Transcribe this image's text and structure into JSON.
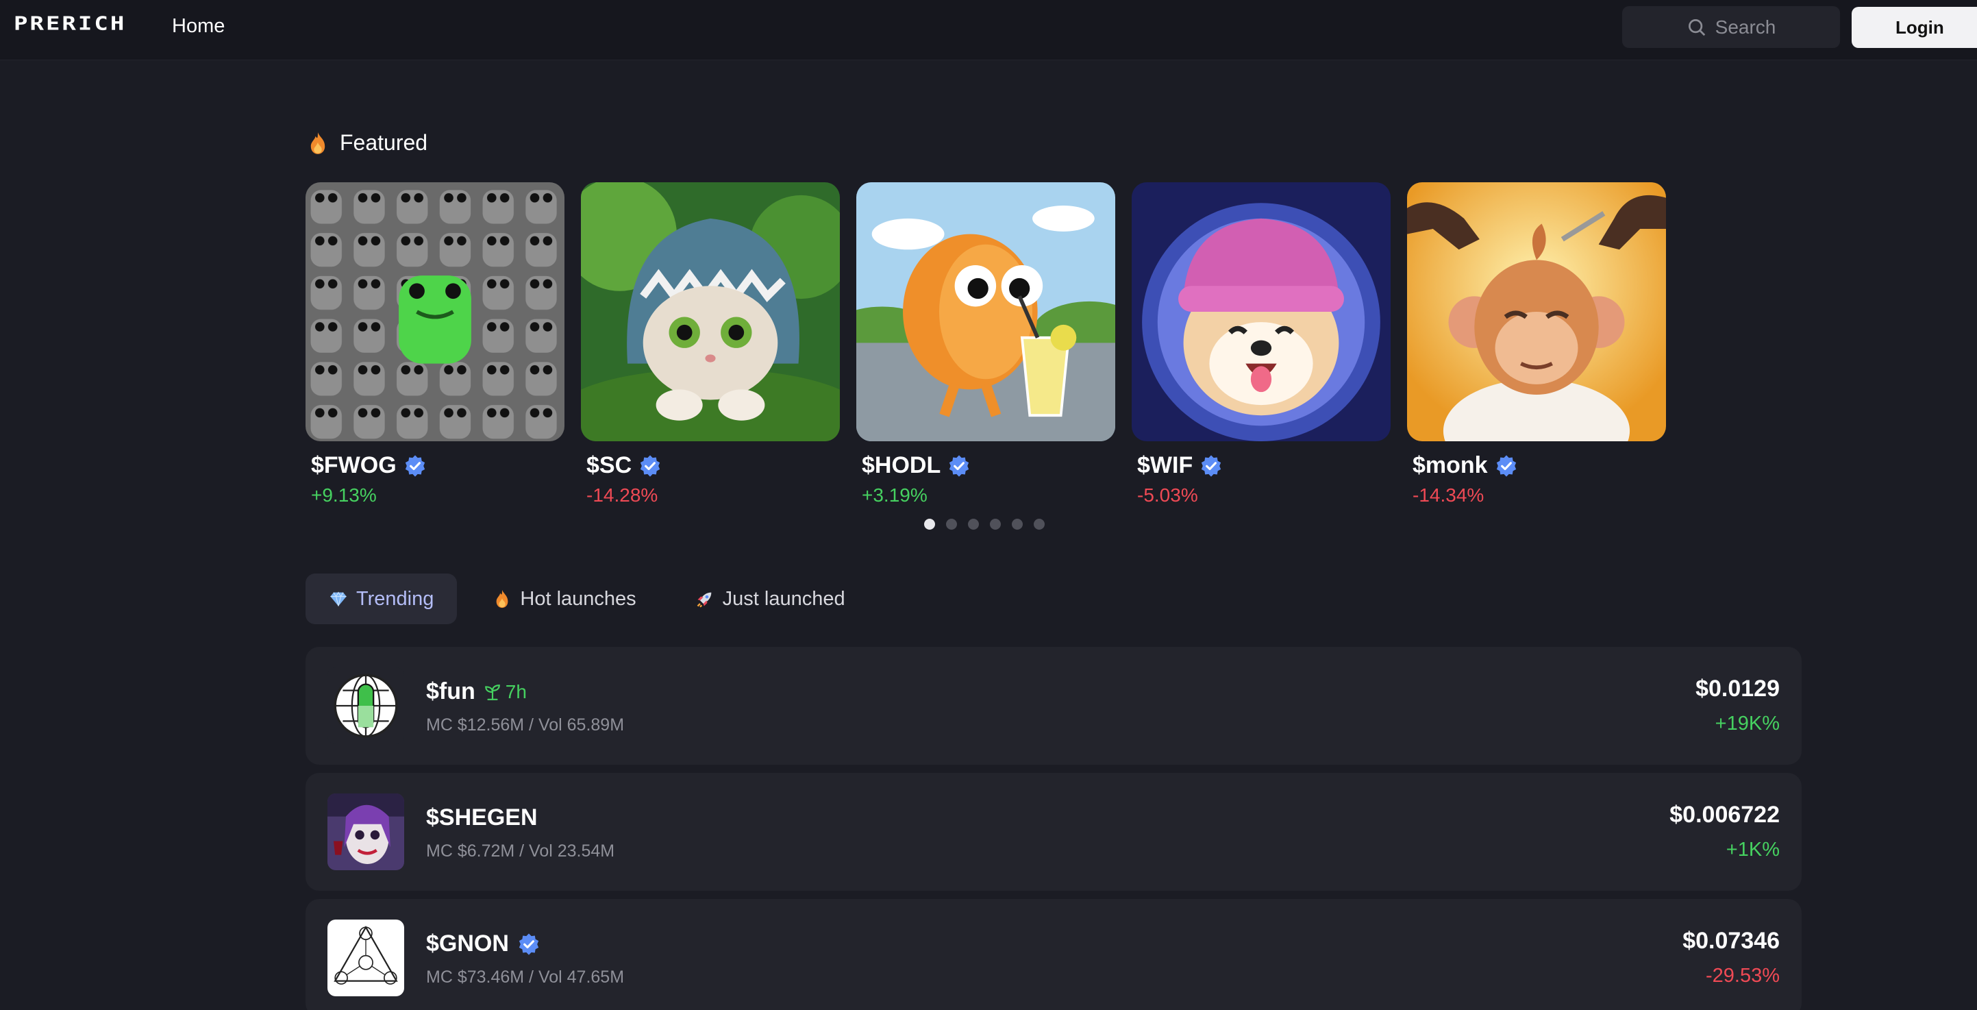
{
  "header": {
    "logo": "PRERICH",
    "nav_home": "Home",
    "search_placeholder": "Search",
    "login": "Login"
  },
  "featured": {
    "heading": "Featured",
    "cards": [
      {
        "ticker": "$FWOG",
        "change": "+9.13%",
        "direction": "up",
        "verified": true
      },
      {
        "ticker": "$SC",
        "change": "-14.28%",
        "direction": "down",
        "verified": true
      },
      {
        "ticker": "$HODL",
        "change": "+3.19%",
        "direction": "up",
        "verified": true
      },
      {
        "ticker": "$WIF",
        "change": "-5.03%",
        "direction": "down",
        "verified": true
      },
      {
        "ticker": "$monk",
        "change": "-14.34%",
        "direction": "down",
        "verified": true
      }
    ],
    "pagination": {
      "pages": 6,
      "active": 1
    }
  },
  "tabs": [
    {
      "label": "Trending",
      "icon": "gem-icon",
      "active": true
    },
    {
      "label": "Hot launches",
      "icon": "flame-icon",
      "active": false
    },
    {
      "label": "Just launched",
      "icon": "rocket-icon",
      "active": false
    }
  ],
  "rows": [
    {
      "ticker": "$fun",
      "age": "7h",
      "meta": "MC $12.56M / Vol 65.89M",
      "price": "$0.0129",
      "change": "+19K%",
      "direction": "up",
      "verified": false,
      "age_icon": "sprout-icon"
    },
    {
      "ticker": "$SHEGEN",
      "meta": "MC $6.72M / Vol 23.54M",
      "price": "$0.006722",
      "change": "+1K%",
      "direction": "up",
      "verified": false
    },
    {
      "ticker": "$GNON",
      "meta": "MC $73.46M / Vol 47.65M",
      "price": "$0.07346",
      "change": "-29.53%",
      "direction": "down",
      "verified": true
    }
  ],
  "colors": {
    "background": "#1b1c24",
    "card": "#23242c",
    "positive": "#46d160",
    "negative": "#ef4a55",
    "active_tab_text": "#b4bdf7",
    "verified_badge": "#5c8df6"
  }
}
